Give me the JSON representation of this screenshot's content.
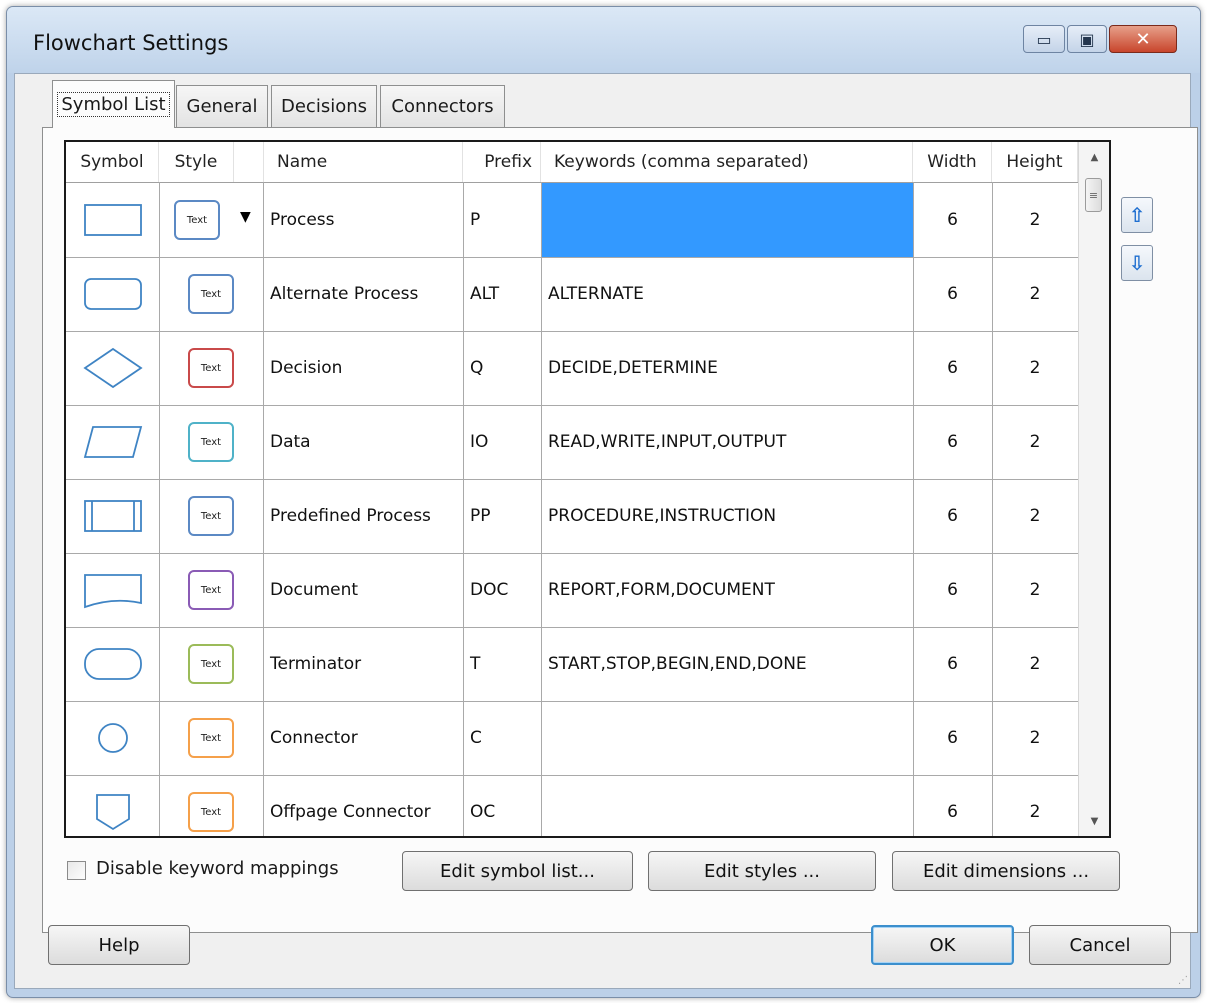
{
  "window": {
    "title": "Flowchart Settings",
    "minimize_glyph": "▭",
    "maximize_glyph": "▣",
    "close_glyph": "✕"
  },
  "tabs": [
    {
      "label": "Symbol List",
      "active": true
    },
    {
      "label": "General",
      "active": false
    },
    {
      "label": "Decisions",
      "active": false
    },
    {
      "label": "Connectors",
      "active": false
    }
  ],
  "table": {
    "headers": [
      "Symbol",
      "Style",
      "Name",
      "Prefix",
      "Keywords (comma separated)",
      "Width",
      "Height"
    ],
    "style_chip_text": "Text",
    "rows": [
      {
        "symbol": "process-icon",
        "style_color": "#5b89c4",
        "name": "Process",
        "prefix": "P",
        "keywords": "",
        "width": "6",
        "height": "2"
      },
      {
        "symbol": "alternate-process-icon",
        "style_color": "#5b89c4",
        "name": "Alternate Process",
        "prefix": "ALT",
        "keywords": "ALTERNATE",
        "width": "6",
        "height": "2"
      },
      {
        "symbol": "decision-icon",
        "style_color": "#c94a4a",
        "name": "Decision",
        "prefix": "Q",
        "keywords": "DECIDE,DETERMINE",
        "width": "6",
        "height": "2"
      },
      {
        "symbol": "data-icon",
        "style_color": "#4fb2c8",
        "name": "Data",
        "prefix": "IO",
        "keywords": "READ,WRITE,INPUT,OUTPUT",
        "width": "6",
        "height": "2"
      },
      {
        "symbol": "predefined-process-icon",
        "style_color": "#5b89c4",
        "name": "Predefined Process",
        "prefix": "PP",
        "keywords": "PROCEDURE,INSTRUCTION",
        "width": "6",
        "height": "2"
      },
      {
        "symbol": "document-icon",
        "style_color": "#8a5bb5",
        "name": "Document",
        "prefix": "DOC",
        "keywords": "REPORT,FORM,DOCUMENT",
        "width": "6",
        "height": "2"
      },
      {
        "symbol": "terminator-icon",
        "style_color": "#9bbb59",
        "name": "Terminator",
        "prefix": "T",
        "keywords": "START,STOP,BEGIN,END,DONE",
        "width": "6",
        "height": "2"
      },
      {
        "symbol": "connector-icon",
        "style_color": "#f5a04a",
        "name": "Connector",
        "prefix": "C",
        "keywords": "",
        "width": "6",
        "height": "2"
      },
      {
        "symbol": "offpage-connector-icon",
        "style_color": "#f5a04a",
        "name": "Offpage Connector",
        "prefix": "OC",
        "keywords": "",
        "width": "6",
        "height": "2"
      }
    ],
    "selected_color": "#3399ff"
  },
  "side_buttons": {
    "move_up_glyph": "⇧",
    "move_down_glyph": "⇩"
  },
  "options": {
    "disable_keyword_label": "Disable keyword mappings",
    "disable_keyword_checked": false
  },
  "buttons": {
    "edit_symbol_list": "Edit symbol list...",
    "edit_styles": "Edit styles ...",
    "edit_dimensions": "Edit dimensions ...",
    "help": "Help",
    "ok": "OK",
    "cancel": "Cancel"
  },
  "colors": {
    "symbol_stroke": "#3f84c4",
    "focus_border": "#3c8fcd"
  }
}
